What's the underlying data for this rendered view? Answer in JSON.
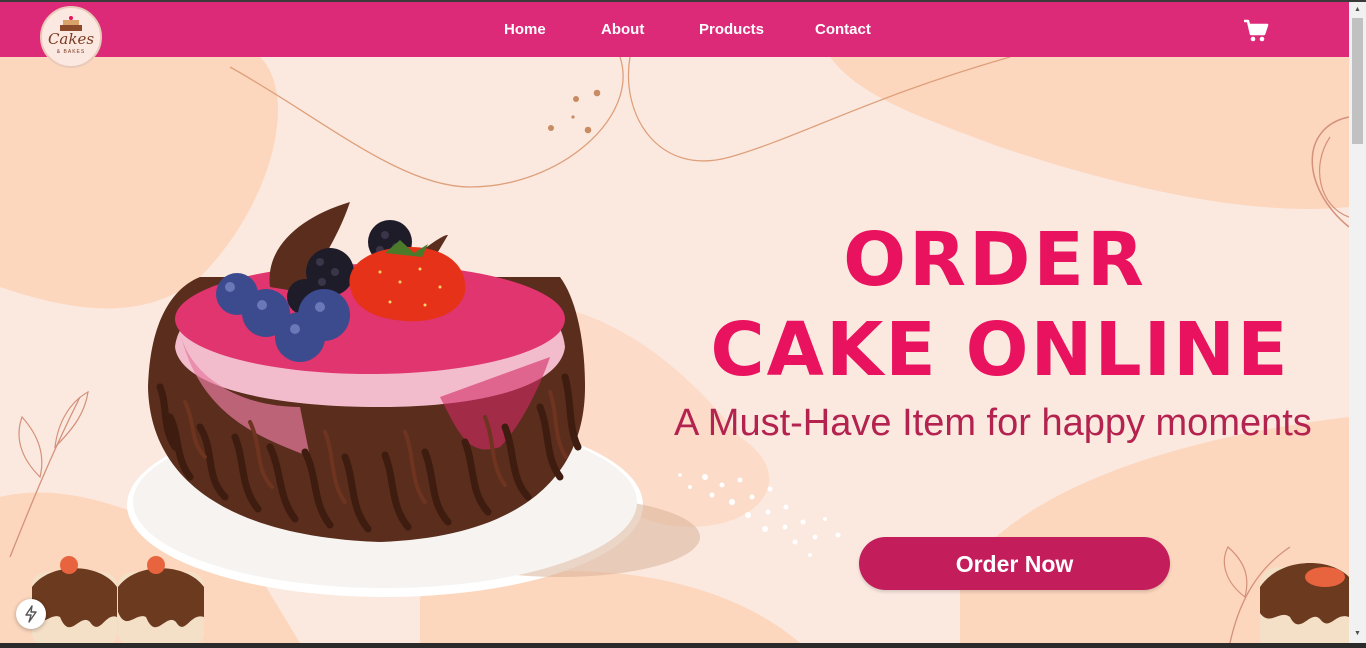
{
  "brand": {
    "logo_text": "Cakes",
    "logo_sub": "& BAKES"
  },
  "nav": {
    "items": [
      {
        "label": "Home"
      },
      {
        "label": "About"
      },
      {
        "label": "Products"
      },
      {
        "label": "Contact"
      }
    ],
    "cart_icon": "shopping-cart-icon"
  },
  "hero": {
    "title_line1": "ORDER",
    "title_line2": "CAKE ONLINE",
    "tagline": "A Must-Have Item for happy moments",
    "cta_label": "Order Now"
  },
  "colors": {
    "navbar": "#dc2a78",
    "title": "#e8125e",
    "cta": "#c41d5c",
    "background": "#fbe9e0",
    "blob": "#fcd6bd"
  }
}
